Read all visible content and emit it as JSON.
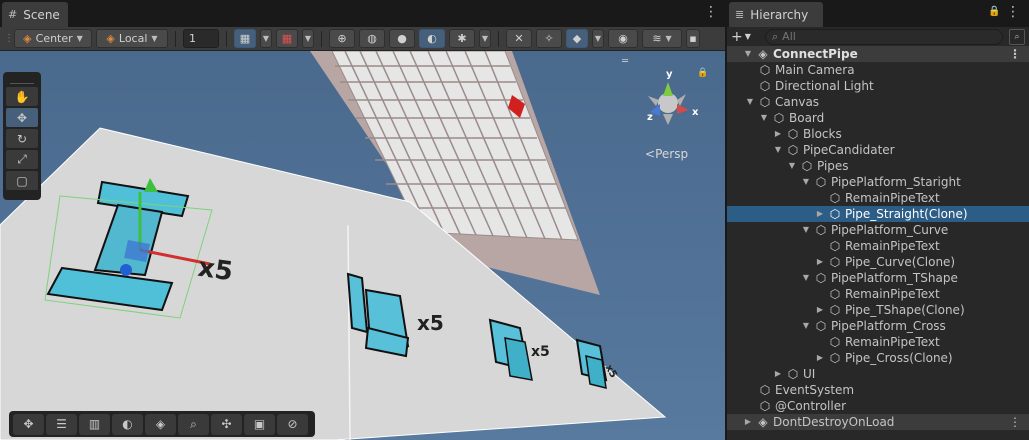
{
  "scene": {
    "tab_label": "Scene",
    "toolbar": {
      "pivot_label": "Center",
      "space_label": "Local",
      "grid_value": "1"
    },
    "persp_label": "Persp",
    "overlay_labels": [
      "x5",
      "x5",
      "x5",
      "x5"
    ],
    "gizmo_axes": [
      "y",
      "x",
      "z"
    ]
  },
  "hierarchy": {
    "tab_label": "Hierarchy",
    "search_placeholder": "All",
    "items": [
      {
        "label": "ConnectPipe",
        "depth": 0,
        "arrow": "down",
        "scene": true
      },
      {
        "label": "Main Camera",
        "depth": 1,
        "arrow": ""
      },
      {
        "label": "Directional Light",
        "depth": 1,
        "arrow": ""
      },
      {
        "label": "Canvas",
        "depth": 1,
        "arrow": "down"
      },
      {
        "label": "Board",
        "depth": 2,
        "arrow": "down"
      },
      {
        "label": "Blocks",
        "depth": 3,
        "arrow": "right"
      },
      {
        "label": "PipeCandidater",
        "depth": 3,
        "arrow": "down"
      },
      {
        "label": "Pipes",
        "depth": 4,
        "arrow": "down"
      },
      {
        "label": "PipePlatform_Staright",
        "depth": 5,
        "arrow": "down"
      },
      {
        "label": "RemainPipeText",
        "depth": 6,
        "arrow": ""
      },
      {
        "label": "Pipe_Straight(Clone)",
        "depth": 6,
        "arrow": "right",
        "selected": true
      },
      {
        "label": "PipePlatform_Curve",
        "depth": 5,
        "arrow": "down"
      },
      {
        "label": "RemainPipeText",
        "depth": 6,
        "arrow": ""
      },
      {
        "label": "Pipe_Curve(Clone)",
        "depth": 6,
        "arrow": "right"
      },
      {
        "label": "PipePlatform_TShape",
        "depth": 5,
        "arrow": "down"
      },
      {
        "label": "RemainPipeText",
        "depth": 6,
        "arrow": ""
      },
      {
        "label": "Pipe_TShape(Clone)",
        "depth": 6,
        "arrow": "right"
      },
      {
        "label": "PipePlatform_Cross",
        "depth": 5,
        "arrow": "down"
      },
      {
        "label": "RemainPipeText",
        "depth": 6,
        "arrow": ""
      },
      {
        "label": "Pipe_Cross(Clone)",
        "depth": 6,
        "arrow": "right"
      },
      {
        "label": "UI",
        "depth": 3,
        "arrow": "right"
      },
      {
        "label": "EventSystem",
        "depth": 1,
        "arrow": ""
      },
      {
        "label": "@Controller",
        "depth": 1,
        "arrow": ""
      },
      {
        "label": "DontDestroyOnLoad",
        "depth": 0,
        "arrow": "right",
        "scene": true,
        "dontdestroy": true
      }
    ]
  }
}
